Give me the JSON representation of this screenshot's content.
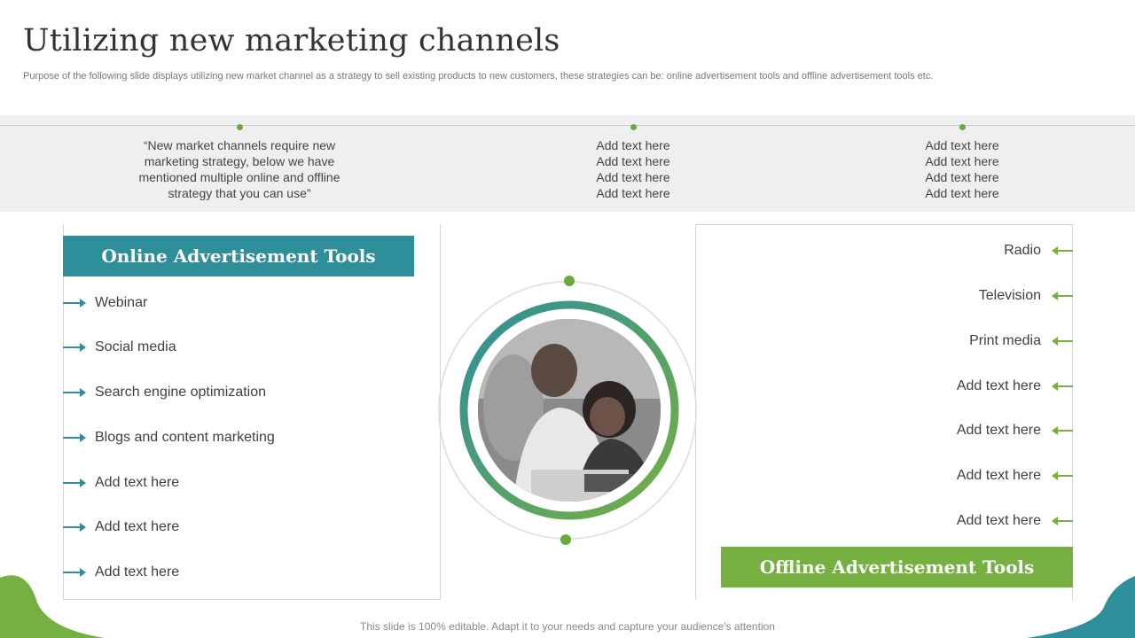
{
  "title": "Utilizing new marketing channels",
  "subtitle": "Purpose of the following slide displays utilizing new market channel as a strategy to sell existing products to new customers, these strategies can be: online advertisement tools and offline advertisement tools etc.",
  "band": {
    "quote_lines": [
      "“New market channels require new",
      "marketing strategy, below we have",
      "mentioned multiple online and offline",
      "strategy that you can use”"
    ],
    "col2_lines": [
      "Add text here",
      "Add text here",
      "Add text here",
      "Add text here"
    ],
    "col3_lines": [
      "Add text here",
      "Add text here",
      "Add text here",
      "Add text here"
    ]
  },
  "online": {
    "header": "Online Advertisement  Tools",
    "items": [
      "Webinar",
      "Social media",
      "Search engine optimization",
      "Blogs and content marketing",
      "Add text here",
      "Add text here",
      "Add text here"
    ]
  },
  "offline": {
    "header": "Offline Advertisement  Tools",
    "items": [
      "Radio",
      "Television",
      "Print media",
      "Add text here",
      "Add text here",
      "Add text here",
      "Add text here"
    ]
  },
  "footer": "This slide is 100% editable. Adapt it to your needs and capture your audience's attention",
  "colors": {
    "teal": "#2e8f9a",
    "green": "#76b041",
    "band": "#efefef"
  }
}
